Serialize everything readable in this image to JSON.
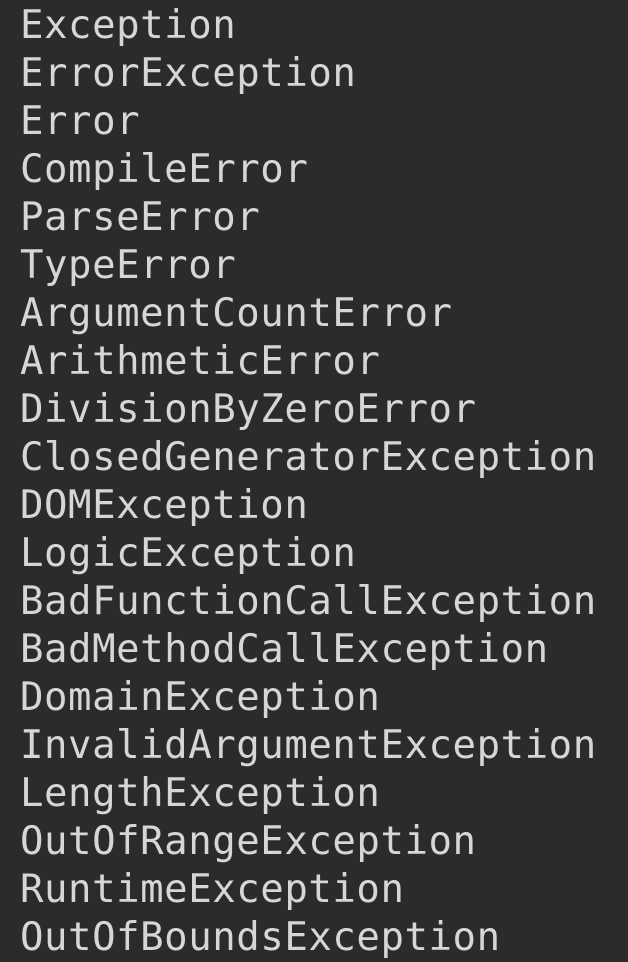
{
  "lines": [
    "Exception",
    "ErrorException",
    "Error",
    "CompileError",
    "ParseError",
    "TypeError",
    "ArgumentCountError",
    "ArithmeticError",
    "DivisionByZeroError",
    "ClosedGeneratorException",
    "DOMException",
    "LogicException",
    "BadFunctionCallException",
    "BadMethodCallException",
    "DomainException",
    "InvalidArgumentException",
    "LengthException",
    "OutOfRangeException",
    "RuntimeException",
    "OutOfBoundsException"
  ],
  "colors": {
    "background": "#2b2b2b",
    "text": "#d6d6d6"
  }
}
